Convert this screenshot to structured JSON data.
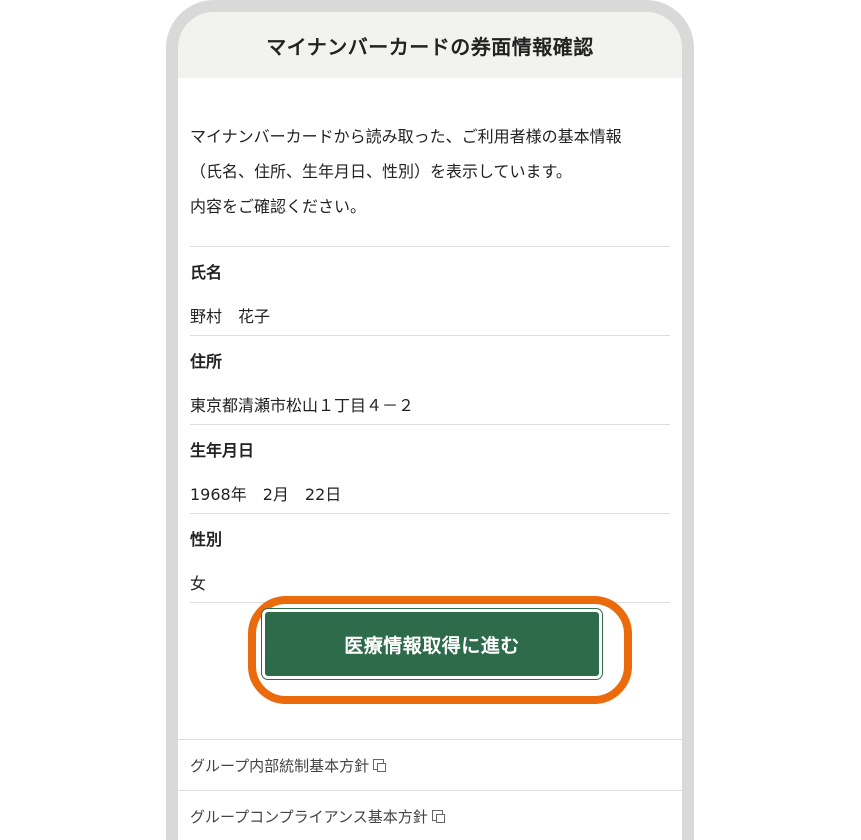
{
  "header": {
    "title": "マイナンバーカードの券面情報確認"
  },
  "intro": {
    "line1": "マイナンバーカードから読み取った、ご利用者様の基本情報",
    "line2": "（氏名、住所、生年月日、性別）を表示しています。",
    "line3": "内容をご確認ください。"
  },
  "fields": [
    {
      "label": "氏名",
      "value": "野村　花子"
    },
    {
      "label": "住所",
      "value": "東京都清瀬市松山１丁目４－２"
    },
    {
      "label": "生年月日",
      "value": "1968年　2月　22日"
    },
    {
      "label": "性別",
      "value": "女"
    }
  ],
  "cta": {
    "label": "医療情報取得に進む",
    "highlight_color": "#ea6a0c",
    "button_color": "#2e6b4b"
  },
  "links": [
    {
      "label": "グループ内部統制基本方針",
      "icon": "external-link-icon"
    },
    {
      "label": "グループコンプライアンス基本方針",
      "icon": "external-link-icon"
    }
  ]
}
